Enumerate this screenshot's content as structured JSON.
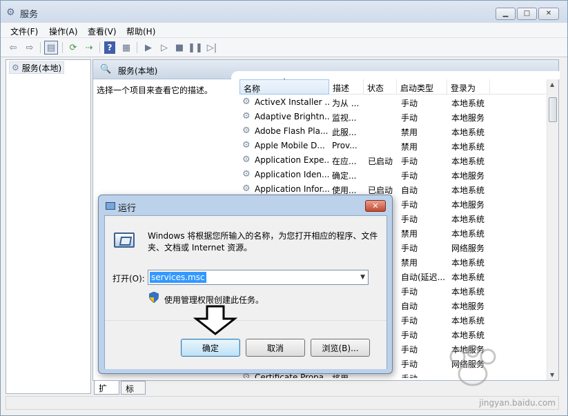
{
  "window": {
    "title": "服务"
  },
  "menubar": [
    "文件(F)",
    "操作(A)",
    "查看(V)",
    "帮助(H)"
  ],
  "left_pane": {
    "node": "服务(本地)"
  },
  "right_pane": {
    "header": "服务(本地)",
    "description": "选择一个项目来查看它的描述。",
    "columns": [
      "名称",
      "描述",
      "状态",
      "启动类型",
      "登录为"
    ],
    "rows": [
      [
        "ActiveX Installer ...",
        "为从 ...",
        "",
        "手动",
        "本地系统"
      ],
      [
        "Adaptive Brightn...",
        "监视...",
        "",
        "手动",
        "本地服务"
      ],
      [
        "Adobe Flash Pla...",
        "此服...",
        "",
        "禁用",
        "本地系统"
      ],
      [
        "Apple Mobile D...",
        "Prov...",
        "",
        "禁用",
        "本地系统"
      ],
      [
        "Application Expe...",
        "在应...",
        "已启动",
        "手动",
        "本地系统"
      ],
      [
        "Application Iden...",
        "确定...",
        "",
        "手动",
        "本地服务"
      ],
      [
        "Application Infor...",
        "使用...",
        "已启动",
        "自动",
        "本地系统"
      ],
      [
        "",
        "",
        "",
        "手动",
        "本地服务"
      ],
      [
        "",
        "",
        "",
        "手动",
        "本地系统"
      ],
      [
        "",
        "",
        "",
        "禁用",
        "本地系统"
      ],
      [
        "",
        "",
        "",
        "手动",
        "网络服务"
      ],
      [
        "",
        "",
        "",
        "禁用",
        "本地系统"
      ],
      [
        "",
        "",
        "",
        "自动(延迟...",
        "本地系统"
      ],
      [
        "",
        "",
        "",
        "手动",
        "本地系统"
      ],
      [
        "",
        "",
        "",
        "自动",
        "本地服务"
      ],
      [
        "",
        "",
        "",
        "手动",
        "本地系统"
      ],
      [
        "",
        "",
        "",
        "手动",
        "本地系统"
      ],
      [
        "",
        "",
        "",
        "手动",
        "本地服务"
      ],
      [
        "",
        "",
        "",
        "手动",
        "网络服务"
      ],
      [
        "Certificate Propa...",
        "将用...",
        "",
        "手动",
        ""
      ]
    ]
  },
  "tabs": [
    "扩展",
    "标准"
  ],
  "run_dialog": {
    "title": "运行",
    "message": "Windows 将根据您所输入的名称，为您打开相应的程序、文件夹、文档或 Internet 资源。",
    "open_label": "打开(O):",
    "open_value": "services.msc",
    "admin_note": "使用管理权限创建此任务。",
    "ok": "确定",
    "cancel": "取消",
    "browse": "浏览(B)..."
  },
  "watermark": {
    "text": "jingyan.baidu.com"
  }
}
